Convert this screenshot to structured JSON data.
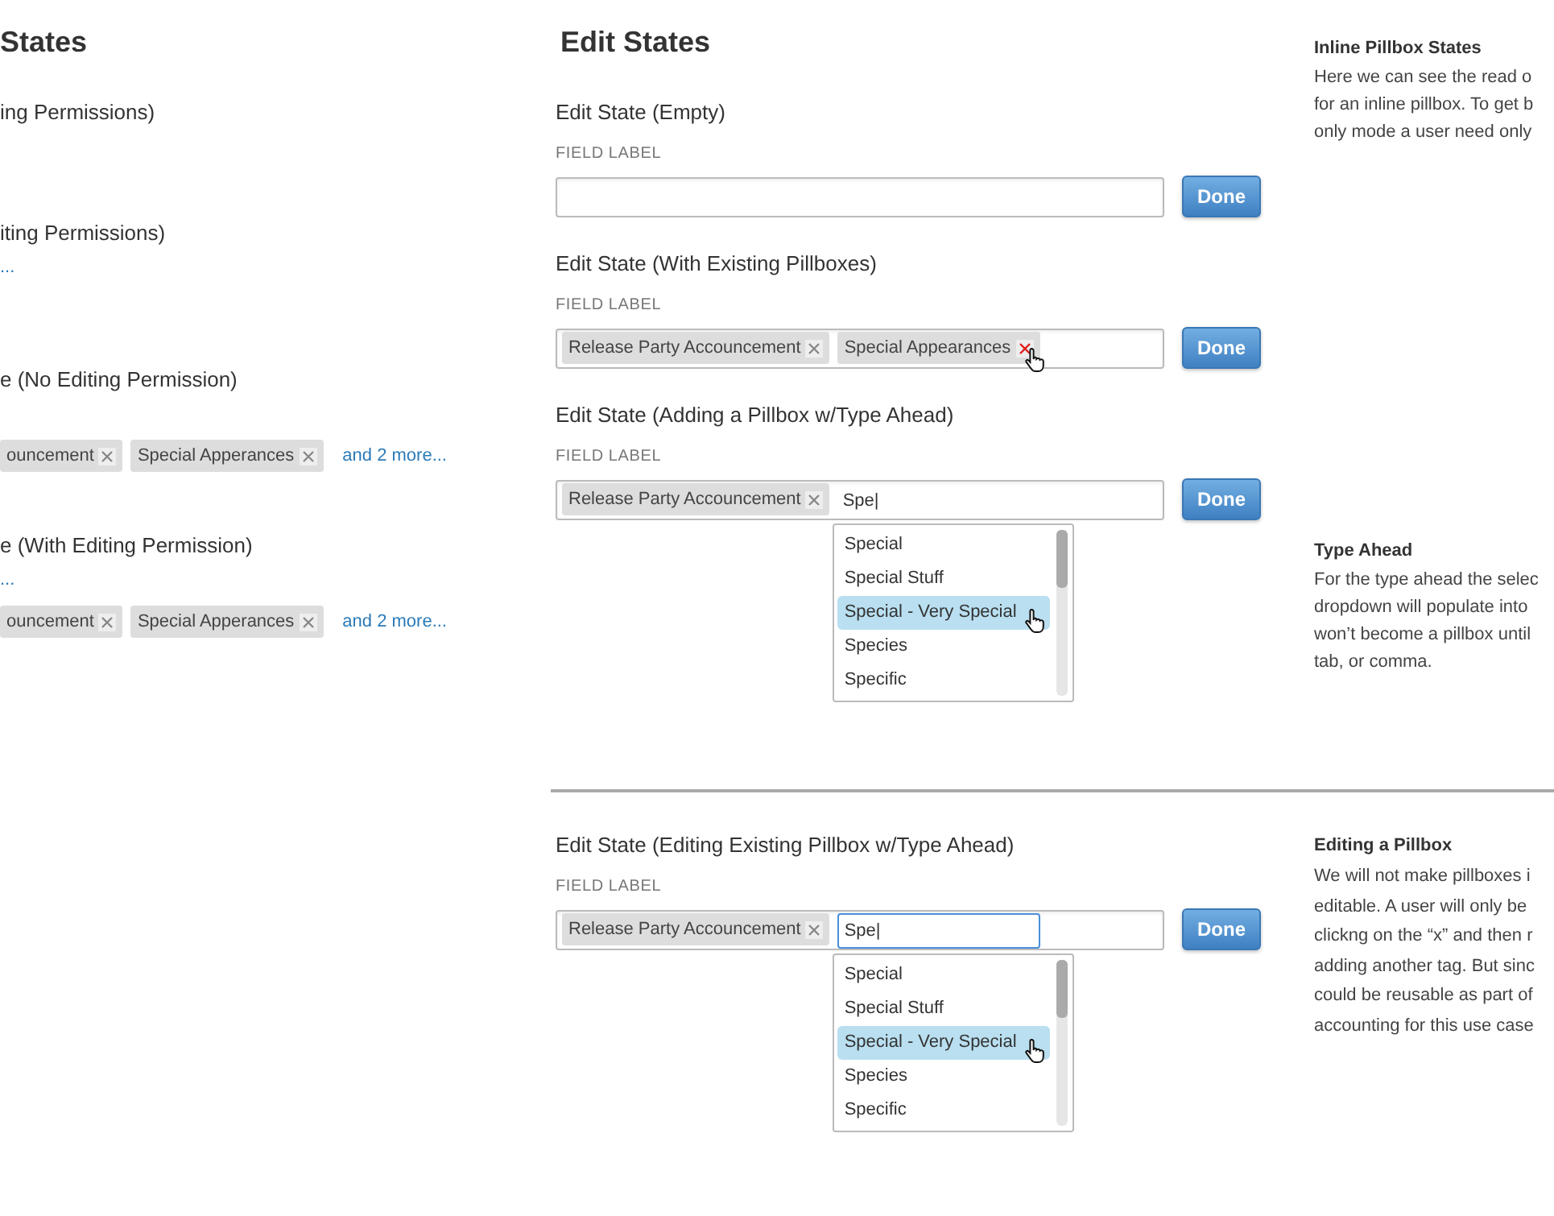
{
  "left_column": {
    "heading": "States",
    "sections": [
      {
        "title": "ing Permissions)"
      },
      {
        "title": "iting Permissions)",
        "link": "..."
      },
      {
        "title": "e (No Editing Permission)",
        "pills": [
          {
            "label": "ouncement",
            "hover": false
          },
          {
            "label": "Special Apperances",
            "hover": false
          }
        ],
        "more_link": "and 2 more..."
      },
      {
        "title": "e (With Editing Permission)",
        "link": "...",
        "pills": [
          {
            "label": "ouncement",
            "hover": false
          },
          {
            "label": "Special Apperances",
            "hover": false
          }
        ],
        "more_link": "and 2 more..."
      }
    ]
  },
  "edit_states": {
    "heading": "Edit States",
    "sections": [
      {
        "title": "Edit State (Empty)",
        "field_label": "FIELD LABEL",
        "button": "Done"
      },
      {
        "title": "Edit State (With Existing Pillboxes)",
        "field_label": "FIELD LABEL",
        "pills": [
          {
            "label": "Release Party Accouncement",
            "hover": false
          },
          {
            "label": "Special Appearances",
            "hover": true
          }
        ],
        "button": "Done"
      },
      {
        "title": "Edit State (Adding a Pillbox w/Type Ahead)",
        "field_label": "FIELD LABEL",
        "pills": [
          {
            "label": "Release Party Accouncement",
            "hover": false
          }
        ],
        "typed": "Spe|",
        "typed_focused": false,
        "dropdown": [
          {
            "label": "Special",
            "selected": false
          },
          {
            "label": "Special Stuff",
            "selected": false
          },
          {
            "label": "Special - Very Special",
            "selected": true
          },
          {
            "label": "Species",
            "selected": false
          },
          {
            "label": "Specific",
            "selected": false
          }
        ],
        "button": "Done"
      }
    ]
  },
  "notes": [
    {
      "title": "Inline Pillbox States",
      "lines": [
        "Here we can see the read o",
        "for an inline pillbox. To get b",
        "only mode a user need only"
      ]
    },
    {
      "title": "Type Ahead",
      "lines": [
        "For the type ahead the selec",
        "dropdown will populate into",
        "won’t become a pillbox until",
        "tab, or comma."
      ]
    }
  ],
  "lower": {
    "section": {
      "title": "Edit State (Editing Existing Pillbox w/Type Ahead)",
      "field_label": "FIELD LABEL",
      "pills": [
        {
          "label": "Release Party Accouncement",
          "hover": false
        }
      ],
      "typed": "Spe|",
      "typed_focused": true,
      "dropdown": [
        {
          "label": "Special",
          "selected": false
        },
        {
          "label": "Special Stuff",
          "selected": false
        },
        {
          "label": "Special - Very Special",
          "selected": true
        },
        {
          "label": "Species",
          "selected": false
        },
        {
          "label": "Specific",
          "selected": false
        }
      ],
      "button": "Done"
    },
    "note": {
      "title": "Editing a Pillbox",
      "lines": [
        "We will not make pillboxes i",
        "editable. A user will only be",
        "clickng on the “x” and then r",
        "adding another tag. But sinc",
        "could be reusable as part of",
        "accounting for this use case"
      ]
    }
  }
}
